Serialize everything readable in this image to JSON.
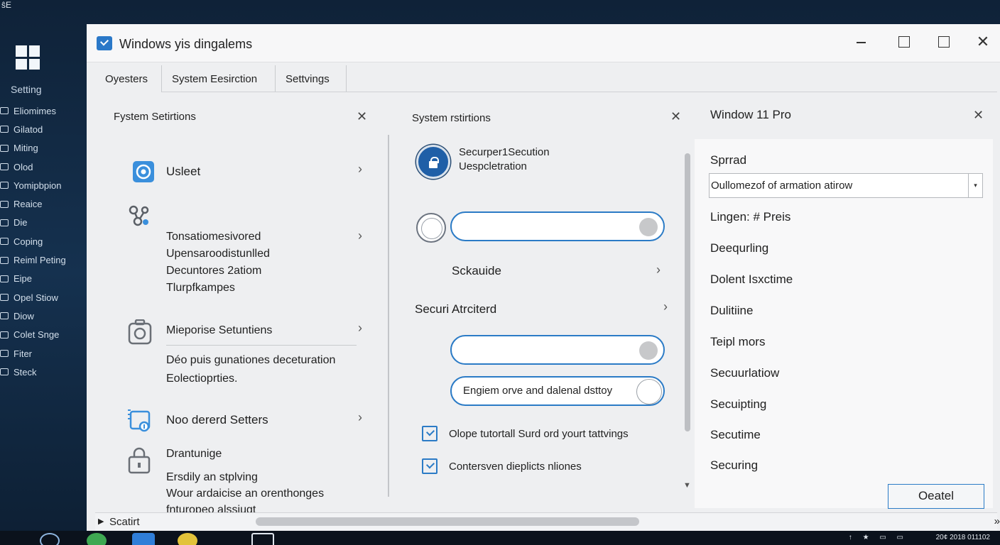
{
  "corner_glyph": "ŝE",
  "sidebar": {
    "title": "Setting",
    "items": [
      {
        "label": "Eliomimes"
      },
      {
        "label": "Gilatod"
      },
      {
        "label": "Miting"
      },
      {
        "label": "Olod"
      },
      {
        "label": "Yomipbpion"
      },
      {
        "label": "Reaice"
      },
      {
        "label": "Die"
      },
      {
        "label": "Coping"
      },
      {
        "label": "Reiml Peting"
      },
      {
        "label": "Eipe"
      },
      {
        "label": "Opel Stiow"
      },
      {
        "label": "Diow"
      },
      {
        "label": "Colet Snge"
      },
      {
        "label": "Fiter"
      },
      {
        "label": "Steck"
      }
    ]
  },
  "window": {
    "title": "Windows yis dingalems",
    "close_glyph": "✕"
  },
  "tabs": [
    {
      "label": "Oyesters"
    },
    {
      "label": "System Eesirction"
    },
    {
      "label": "Settvings"
    }
  ],
  "pane1": {
    "header": "Fystem Setirtions",
    "close_glyph": "✕",
    "chevron": "›",
    "rows": [
      {
        "title": "Usleet",
        "lines": []
      },
      {
        "title": "Tonsatiomesivored",
        "lines": [
          "Upensaroodistunlled",
          "Decuntores 2atiom",
          "Tlurpfkampes"
        ]
      },
      {
        "title": "Mieporise Setuntiens",
        "lines": [
          "Déo puis gunationes deceturation",
          "Eolectioprties."
        ]
      },
      {
        "title": "Noo dererd Setters",
        "lines": []
      },
      {
        "title": "Drantunige",
        "lines": [
          "Ersdily an stplving",
          "Wour ardaicise an orenthonges",
          "fnturopeo alssiugt"
        ]
      }
    ]
  },
  "pane2": {
    "header": "System rstirtions",
    "close_glyph": "✕",
    "chevron": "›",
    "security_title": "Securper1Secution",
    "security_sub": "Uespcletration",
    "scheduler_label": "Sckauide",
    "section_label": "Securi Atrciterd",
    "pill_text": "Engiem orve and dalenal dsttoy",
    "links": [
      {
        "label": "Olope tutortall Surd ord yourt tattvings"
      },
      {
        "label": "Contersven dieplicts nliones"
      }
    ],
    "scroll_arrow": "▼"
  },
  "pane3": {
    "header": "Window 11 Pro",
    "close_glyph": "✕",
    "field_label": "Sprrad",
    "select_value": "Oullomezof of armation atirow",
    "select_arrow": "▾",
    "items": [
      {
        "label": "Lingen: # Preis"
      },
      {
        "label": "Deequrling"
      },
      {
        "label": "Dolent Isxctime"
      },
      {
        "label": "Dulitiine"
      },
      {
        "label": "Teipl mors"
      },
      {
        "label": "Secuurlatiow"
      },
      {
        "label": "Secuipting"
      },
      {
        "label": "Secutime"
      },
      {
        "label": "Securing"
      }
    ],
    "ok_label": "Oeatel"
  },
  "statusbar": {
    "arrow": "▶",
    "text": "Scatirt",
    "end_glyph": "»"
  },
  "taskbar": {
    "time": "20¢   2018 011102",
    "tray": "↑ ★ ▭ ▭"
  },
  "colors": {
    "accent": "#2b7bc6",
    "desktop": "#15314f",
    "window_bg": "#eeeff1"
  }
}
